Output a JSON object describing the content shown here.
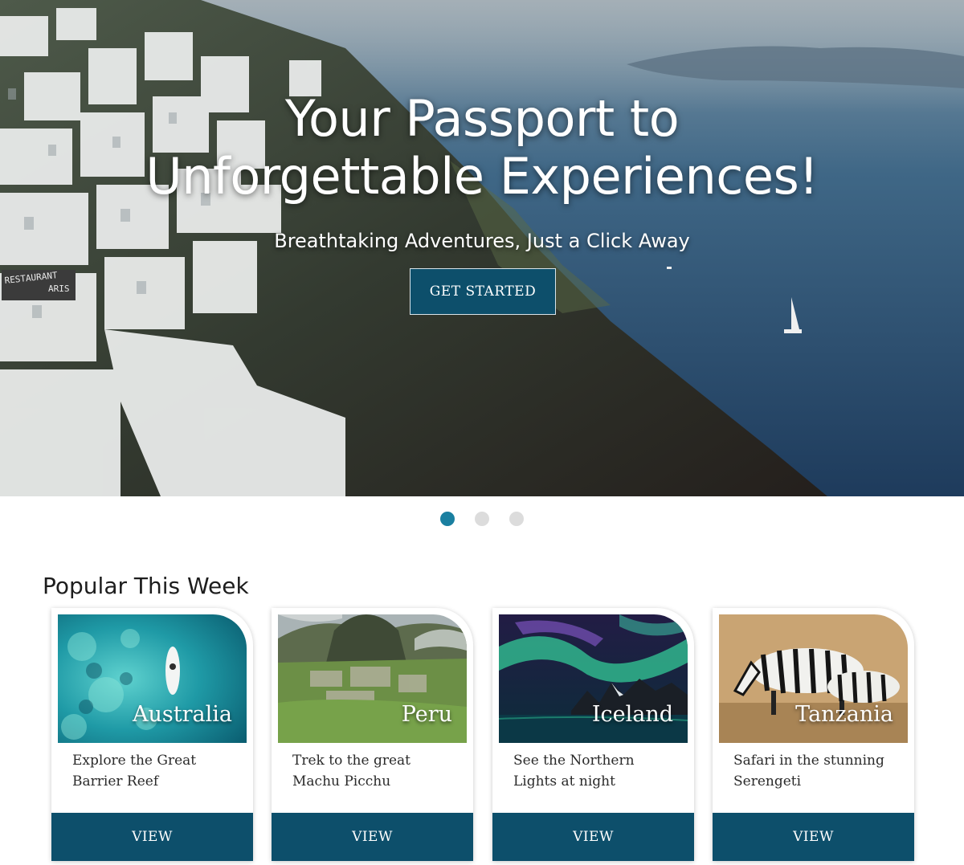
{
  "hero": {
    "title_line1": "Your Passport to",
    "title_line2": "Unforgettable Experiences!",
    "subtitle": "Breathtaking Adventures, Just a Click Away",
    "cta_label": "GET STARTED",
    "sign_line1": "RESTAURANT",
    "sign_line2": "ARIS"
  },
  "carousel": {
    "slide_count": 3,
    "active_index": 0
  },
  "section": {
    "title": "Popular This Week"
  },
  "cards": [
    {
      "place": "Australia",
      "description": "Explore the Great Barrier Reef",
      "button": "VIEW"
    },
    {
      "place": "Peru",
      "description": "Trek to the great Machu Picchu",
      "button": "VIEW"
    },
    {
      "place": "Iceland",
      "description": "See the Northern Lights at night",
      "button": "VIEW"
    },
    {
      "place": "Tanzania",
      "description": "Safari in the stunning Serengeti",
      "button": "VIEW"
    }
  ],
  "colors": {
    "brand": "#0d4f6b",
    "dot_active": "#1a7fa0",
    "dot_inactive": "#dcdcdc"
  }
}
